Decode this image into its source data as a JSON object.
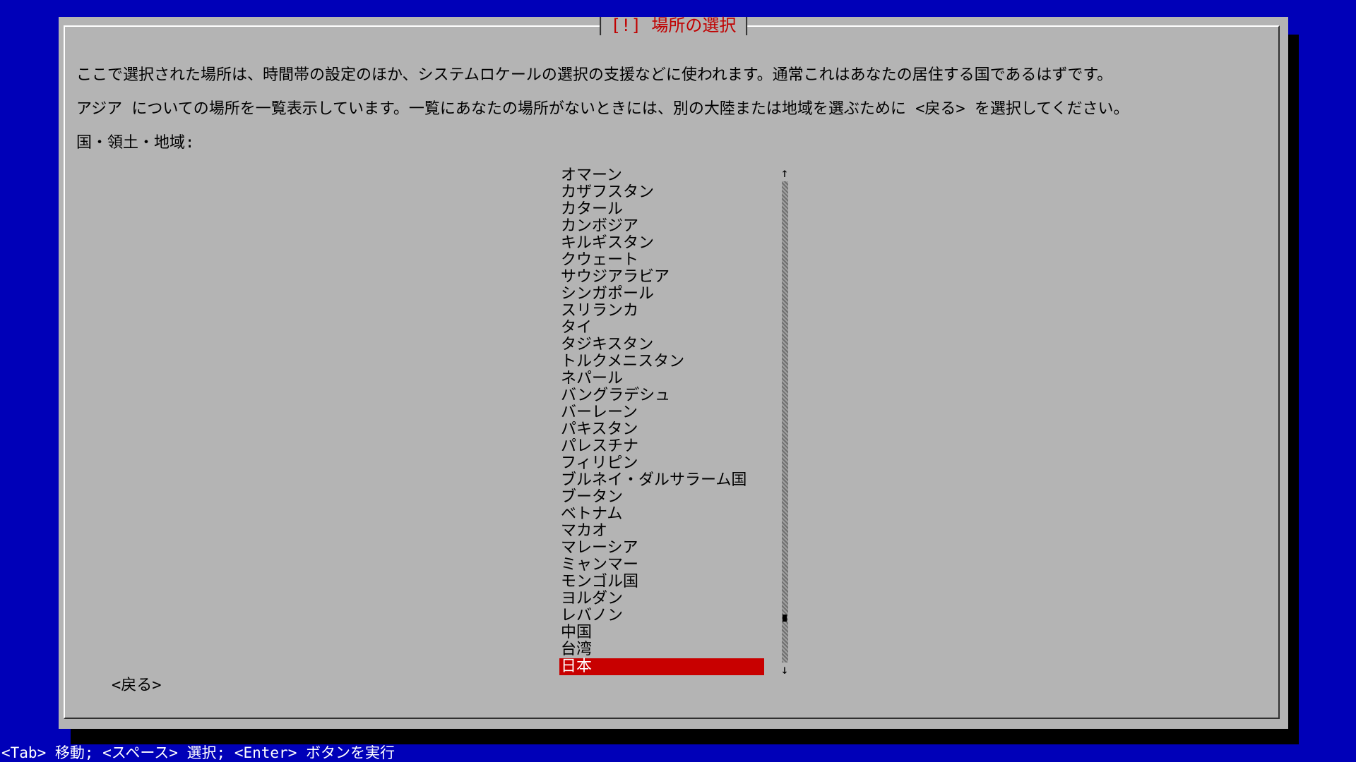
{
  "dialog": {
    "title": "[!] 場所の選択",
    "description_1": "ここで選択された場所は、時間帯の設定のほか、システムロケールの選択の支援などに使われます。通常これはあなたの居住する国であるはずです。",
    "description_2": "アジア についての場所を一覧表示しています。一覧にあなたの場所がないときには、別の大陸または地域を選ぶために <戻る> を選択してください。",
    "field_label": "国・領土・地域:",
    "countries": [
      "オマーン",
      "カザフスタン",
      "カタール",
      "カンボジア",
      "キルギスタン",
      "クウェート",
      "サウジアラビア",
      "シンガポール",
      "スリランカ",
      "タイ",
      "タジキスタン",
      "トルクメニスタン",
      "ネパール",
      "バングラデシュ",
      "バーレーン",
      "パキスタン",
      "パレスチナ",
      "フィリピン",
      "ブルネイ・ダルサラーム国",
      "ブータン",
      "ベトナム",
      "マカオ",
      "マレーシア",
      "ミャンマー",
      "モンゴル国",
      "ヨルダン",
      "レバノン",
      "中国",
      "台湾",
      "日本"
    ],
    "selected_country": "日本",
    "scroll_up_arrow": "↑",
    "scroll_down_arrow": "↓",
    "back_button": "<戻る>"
  },
  "statusbar": {
    "text": "<Tab> 移動; <スペース> 選択; <Enter> ボタンを実行"
  },
  "colors": {
    "background": "#0000b8",
    "dialog": "#b4b4b4",
    "title": "#c00000",
    "selection": "#c80000"
  }
}
